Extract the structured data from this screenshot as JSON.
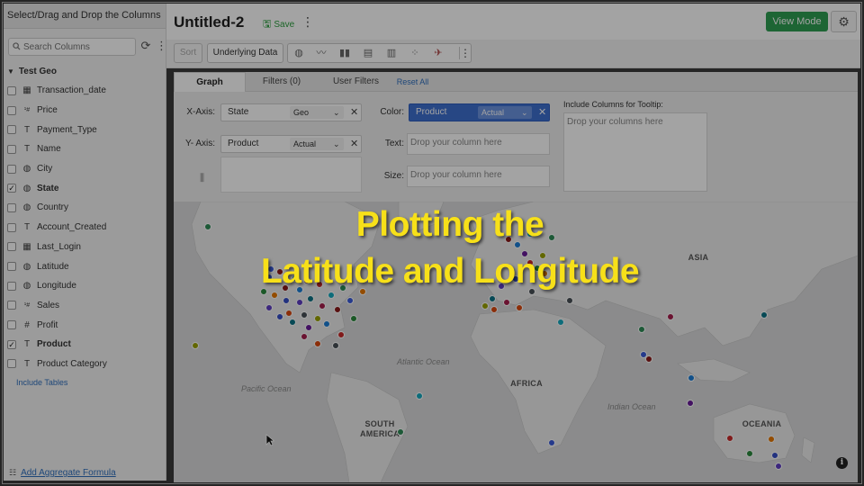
{
  "left_panel": {
    "header": "Select/Drag and Drop the Columns",
    "search_placeholder": "Search Columns",
    "table_name": "Test Geo",
    "fields": [
      {
        "name": "Transaction_date",
        "type_icon": "calendar-icon",
        "checked": false,
        "bold": false
      },
      {
        "name": "Price",
        "type_icon": "currency-number-icon",
        "checked": false,
        "bold": false
      },
      {
        "name": "Payment_Type",
        "type_icon": "text-type-icon",
        "checked": false,
        "bold": false
      },
      {
        "name": "Name",
        "type_icon": "text-type-icon",
        "checked": false,
        "bold": false
      },
      {
        "name": "City",
        "type_icon": "globe-icon",
        "checked": false,
        "bold": false
      },
      {
        "name": "State",
        "type_icon": "globe-icon",
        "checked": true,
        "bold": true
      },
      {
        "name": "Country",
        "type_icon": "globe-icon",
        "checked": false,
        "bold": false
      },
      {
        "name": "Account_Created",
        "type_icon": "text-type-icon",
        "checked": false,
        "bold": false
      },
      {
        "name": "Last_Login",
        "type_icon": "calendar-icon",
        "checked": false,
        "bold": false
      },
      {
        "name": "Latitude",
        "type_icon": "globe-icon",
        "checked": false,
        "bold": false
      },
      {
        "name": "Longitude",
        "type_icon": "globe-icon",
        "checked": false,
        "bold": false
      },
      {
        "name": "Sales",
        "type_icon": "currency-number-icon",
        "checked": false,
        "bold": false
      },
      {
        "name": "Profit",
        "type_icon": "hash-icon",
        "checked": false,
        "bold": false
      },
      {
        "name": "Product",
        "type_icon": "text-type-icon",
        "checked": true,
        "bold": true
      },
      {
        "name": "Product Category",
        "type_icon": "text-type-icon",
        "checked": false,
        "bold": false
      }
    ],
    "include_tables": "Include Tables",
    "add_aggregate": "Add Aggregate Formula"
  },
  "header": {
    "title": "Untitled-2",
    "save_label": "Save",
    "view_mode_label": "View Mode"
  },
  "toolbar": {
    "sort_label": "Sort",
    "underlying_data_label": "Underlying Data",
    "chart_type_icons": [
      "map-chart-icon",
      "line-chart-icon",
      "bar-chart-icon",
      "stacked-bar-icon",
      "column-chart-icon",
      "scatter-chart-icon",
      "geo-chart-icon"
    ]
  },
  "tabs": {
    "graph": "Graph",
    "filters": "Filters (0)",
    "user_filters": "User Filters",
    "reset_all": "Reset All"
  },
  "shelves": {
    "x_axis_label": "X-Axis:",
    "x_field": "State",
    "x_type": "Geo",
    "y_axis_label": "Y- Axis:",
    "y_field": "Product",
    "y_type": "Actual",
    "color_label": "Color:",
    "color_field": "Product",
    "color_type": "Actual",
    "text_label": "Text:",
    "text_placeholder": "Drop your column here",
    "size_label": "Size:",
    "size_placeholder": "Drop your column here",
    "tooltip_label": "Include Columns for Tooltip:",
    "tooltip_placeholder": "Drop your columns here"
  },
  "map": {
    "continent_labels": [
      "ASIA",
      "AFRICA",
      "SOUTH AMERICA",
      "OCEANIA"
    ],
    "ocean_labels": [
      "Atlantic Ocean",
      "Pacific Ocean",
      "Indian Ocean"
    ],
    "dot_colors": [
      "#2e8b57",
      "#3b5bdb",
      "#8b1a1a",
      "#1c7ed6",
      "#6a1b9a",
      "#c92a2a",
      "#2b8a3e",
      "#e67700",
      "#364fc7",
      "#5f3dc4",
      "#0b7285",
      "#a61e4d",
      "#d9480f",
      "#495057",
      "#99a200",
      "#15aabf"
    ]
  },
  "overlay": {
    "line1": "Plotting the",
    "line2": "Latitude and Longitude"
  }
}
